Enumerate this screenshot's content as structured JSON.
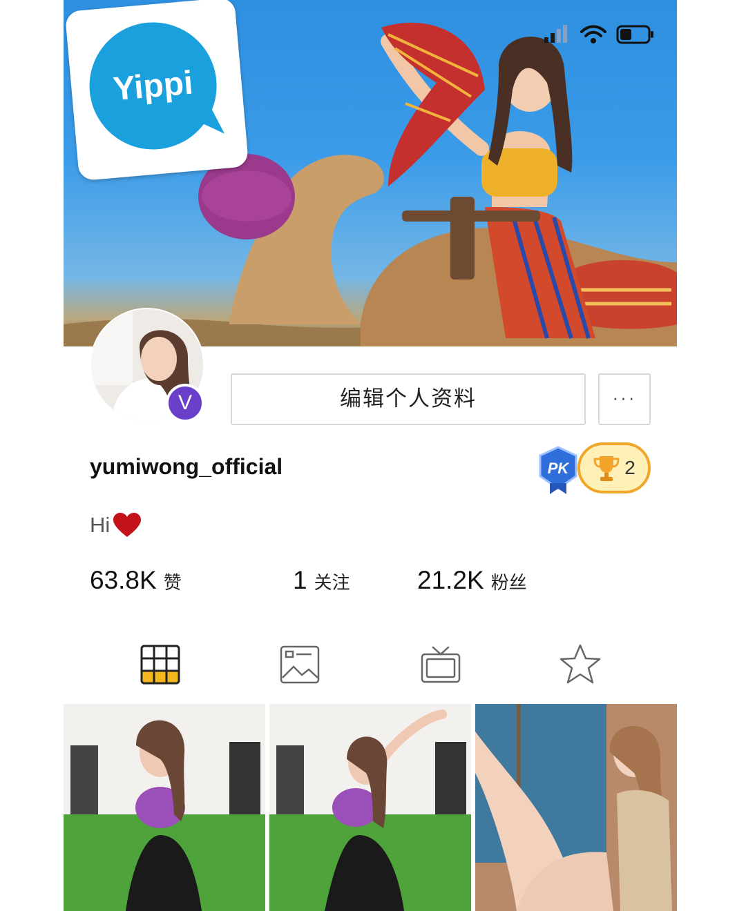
{
  "app": {
    "logo_text": "Yippi"
  },
  "status_bar": {
    "signal": "signal-icon",
    "wifi": "wifi-icon",
    "battery": "battery-icon"
  },
  "profile": {
    "edit_label": "编辑个人资料",
    "more_label": "···",
    "verified_label": "V",
    "username": "yumiwong_official",
    "bio_text": "Hi",
    "pk_label": "PK",
    "trophy_count": "2"
  },
  "stats": [
    {
      "value": "63.8K",
      "label": "赞"
    },
    {
      "value": "1",
      "label": "关注"
    },
    {
      "value": "21.2K",
      "label": "粉丝"
    }
  ],
  "tabs": [
    {
      "icon": "grid-icon",
      "active": true
    },
    {
      "icon": "image-icon",
      "active": false
    },
    {
      "icon": "tv-icon",
      "active": false
    },
    {
      "icon": "star-icon",
      "active": false
    }
  ],
  "colors": {
    "accent": "#f4b81c",
    "verified": "#6a3fc9",
    "trophy_border": "#f0a62a",
    "logo_blue": "#1aa0dd"
  }
}
